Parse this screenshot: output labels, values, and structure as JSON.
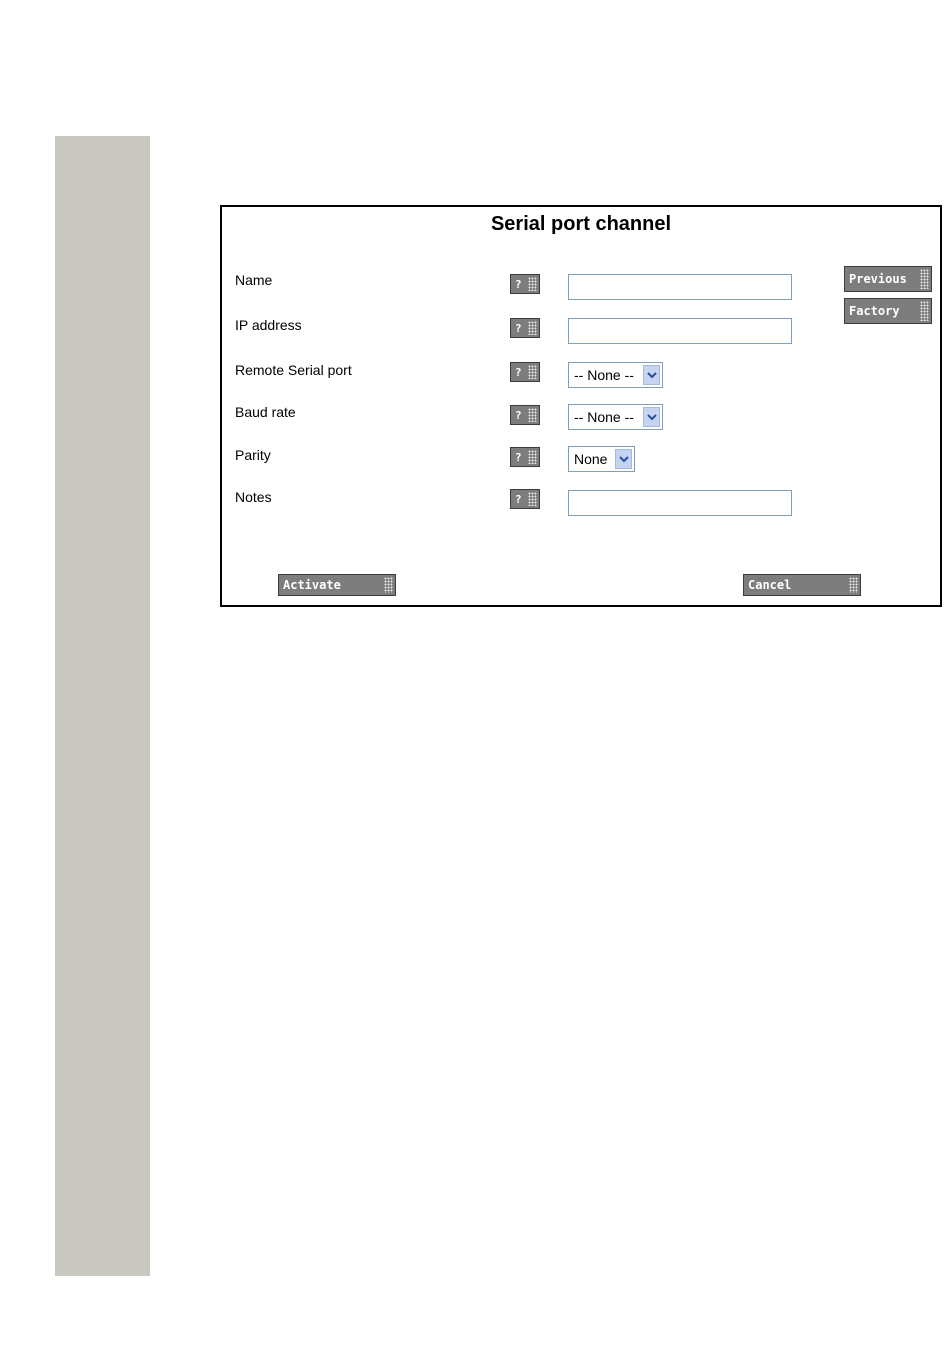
{
  "form": {
    "title": "Serial port channel",
    "help_glyph": "?",
    "fields": {
      "name": {
        "label": "Name",
        "value": ""
      },
      "ip_address": {
        "label": "IP address",
        "value": ""
      },
      "remote_serial_port": {
        "label": "Remote Serial port",
        "selected": "-- None --"
      },
      "baud_rate": {
        "label": "Baud rate",
        "selected": "-- None --"
      },
      "parity": {
        "label": "Parity",
        "selected": "None"
      },
      "notes": {
        "label": "Notes",
        "value": ""
      }
    },
    "buttons": {
      "previous": "Previous",
      "factory": "Factory",
      "activate": "Activate",
      "cancel": "Cancel"
    }
  },
  "colors": {
    "page_stripe": "#c8c8c0",
    "button_gray": "#7d7d7d",
    "input_border": "#7f9db9",
    "dropdown_arrow_bg": "#c4d4f2"
  },
  "icons": {
    "help": "question-mark-icon",
    "dropdown": "chevron-down-icon",
    "grip": "grip-dots-icon"
  }
}
